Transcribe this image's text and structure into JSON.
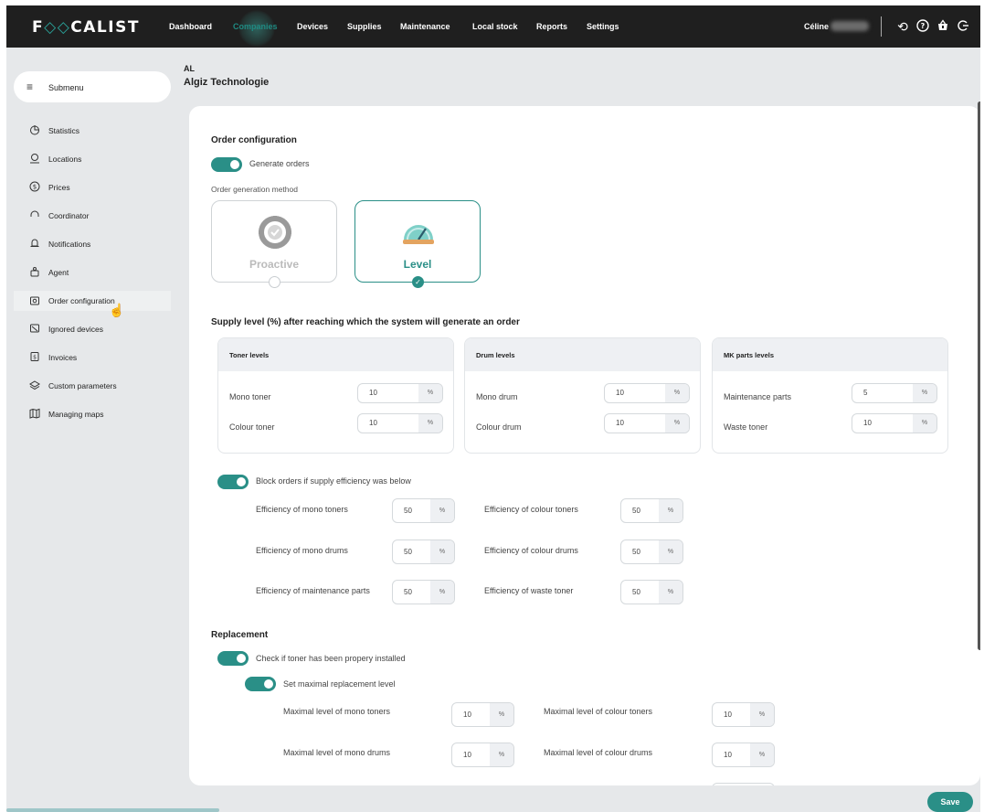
{
  "brand": {
    "logo_text_1": "F",
    "logo_mark": "◇◇",
    "logo_text_2": "CALIST"
  },
  "topnav": {
    "items": [
      "Dashboard",
      "Companies",
      "Devices",
      "Supplies",
      "Maintenance",
      "Local stock",
      "Reports",
      "Settings"
    ],
    "active_index": 1,
    "user_name": "Céline",
    "icons": [
      "history-icon",
      "help-icon",
      "basket-icon",
      "logout-icon"
    ]
  },
  "sidebar": {
    "submenu_label": "Submenu",
    "items": [
      {
        "label": "Statistics",
        "icon": "pie-chart-icon"
      },
      {
        "label": "Locations",
        "icon": "location-icon"
      },
      {
        "label": "Prices",
        "icon": "dollar-icon"
      },
      {
        "label": "Coordinator",
        "icon": "headset-icon"
      },
      {
        "label": "Notifications",
        "icon": "bell-icon"
      },
      {
        "label": "Agent",
        "icon": "agent-icon"
      },
      {
        "label": "Order configuration",
        "icon": "order-config-icon"
      },
      {
        "label": "Ignored devices",
        "icon": "ignored-devices-icon"
      },
      {
        "label": "Invoices",
        "icon": "invoice-icon"
      },
      {
        "label": "Custom parameters",
        "icon": "layers-icon"
      },
      {
        "label": "Managing maps",
        "icon": "map-icon"
      }
    ],
    "active_index": 6
  },
  "header": {
    "short": "AL",
    "company": "Algiz Technologie"
  },
  "order_config": {
    "title": "Order configuration",
    "generate_orders": "Generate orders",
    "method_label": "Order generation method",
    "methods": [
      {
        "label": "Proactive",
        "selected": false
      },
      {
        "label": "Level",
        "selected": true
      }
    ]
  },
  "supply_levels": {
    "title": "Supply level (%) after reaching which the system will generate an order",
    "unit": "%",
    "panels": [
      {
        "title": "Toner levels",
        "rows": [
          {
            "label": "Mono toner",
            "value": "10"
          },
          {
            "label": "Colour toner",
            "value": "10"
          }
        ]
      },
      {
        "title": "Drum levels",
        "rows": [
          {
            "label": "Mono drum",
            "value": "10"
          },
          {
            "label": "Colour drum",
            "value": "10"
          }
        ]
      },
      {
        "title": "MK parts levels",
        "rows": [
          {
            "label": "Maintenance parts",
            "value": "5"
          },
          {
            "label": "Waste toner",
            "value": "10"
          }
        ]
      }
    ]
  },
  "block_orders": {
    "label": "Block orders if supply efficiency was below",
    "unit": "%",
    "rows": [
      {
        "left_label": "Efficiency of mono toners",
        "left_value": "50",
        "right_label": "Efficiency of colour toners",
        "right_value": "50"
      },
      {
        "left_label": "Efficiency of mono drums",
        "left_value": "50",
        "right_label": "Efficiency of colour drums",
        "right_value": "50"
      },
      {
        "left_label": "Efficiency of maintenance parts",
        "left_value": "50",
        "right_label": "Efficiency of waste toner",
        "right_value": "50"
      }
    ]
  },
  "replacement": {
    "title": "Replacement",
    "check_label": "Check if toner has been propery installed",
    "set_max_label": "Set maximal replacement level",
    "unit": "%",
    "rows": [
      {
        "left_label": "Maximal level of mono toners",
        "left_value": "10",
        "right_label": "Maximal level of colour toners",
        "right_value": "10"
      },
      {
        "left_label": "Maximal level of mono drums",
        "left_value": "10",
        "right_label": "Maximal level of colour drums",
        "right_value": "10"
      }
    ]
  },
  "footer": {
    "save_label": "Save"
  },
  "colors": {
    "accent": "#2a8f87",
    "nav_bg": "#1f1f1f",
    "page_bg": "#e6e8ea"
  }
}
